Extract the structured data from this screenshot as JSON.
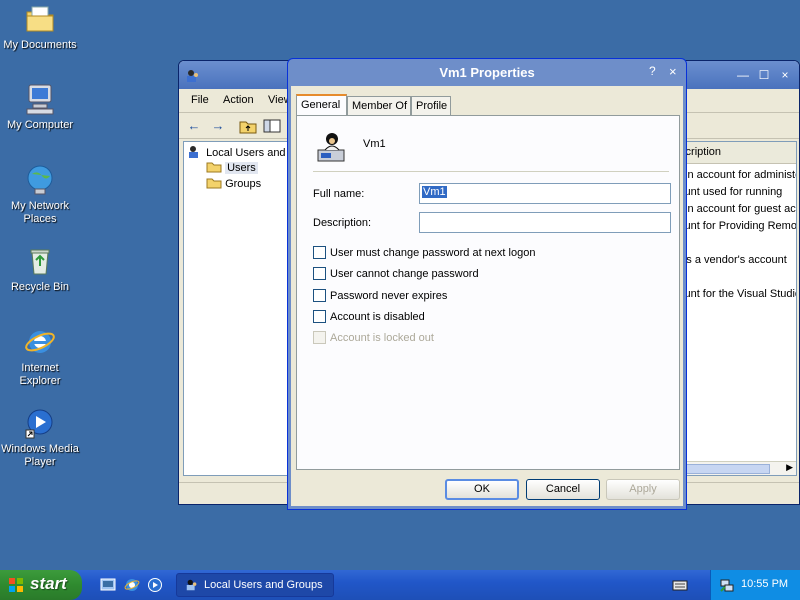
{
  "desktop": {
    "icons": [
      {
        "label_1": "My Documents",
        "label_2": ""
      },
      {
        "label_1": "My Computer",
        "label_2": ""
      },
      {
        "label_1": "My Network",
        "label_2": "Places"
      },
      {
        "label_1": "Recycle Bin",
        "label_2": ""
      },
      {
        "label_1": "Internet",
        "label_2": "Explorer"
      },
      {
        "label_1": "Windows Media",
        "label_2": "Player"
      }
    ]
  },
  "background_window": {
    "menu": [
      "File",
      "Action",
      "View"
    ],
    "tree": {
      "root": "Local Users and Groups",
      "children": [
        "Users",
        "Groups"
      ]
    },
    "list": {
      "column_header": "Description",
      "rows": [
        "Built-in account for administering",
        "Account used for running",
        "Built-in account for guest access",
        "Account for Providing Remote",
        "This is a vendor's account",
        "Account for the Visual Studio"
      ]
    }
  },
  "dialog": {
    "title": "Vm1 Properties",
    "help_label": "?",
    "close_label": "×",
    "tabs": [
      "General",
      "Member Of",
      "Profile"
    ],
    "username": "Vm1",
    "full_name_label": "Full name:",
    "full_name_value": "Vm1",
    "description_label": "Description:",
    "description_value": "",
    "checkboxes": [
      {
        "label": "User must change password at next logon",
        "checked": false,
        "enabled": true
      },
      {
        "label": "User cannot change password",
        "checked": false,
        "enabled": true
      },
      {
        "label": "Password never expires",
        "checked": false,
        "enabled": true
      },
      {
        "label": "Account is disabled",
        "checked": false,
        "enabled": true
      },
      {
        "label": "Account is locked out",
        "checked": false,
        "enabled": false
      }
    ],
    "buttons": {
      "ok": "OK",
      "cancel": "Cancel",
      "apply": "Apply"
    }
  },
  "taskbar": {
    "start_label": "start",
    "task_label": "Local Users and Groups",
    "clock": "10:55 PM"
  },
  "colors": {
    "desktop": "#3b6ca6",
    "dialog_frame": "#6e8ec9",
    "selection": "#316ac5",
    "tab_accent": "#e68b2c",
    "start_green": "#2f8a2f"
  }
}
